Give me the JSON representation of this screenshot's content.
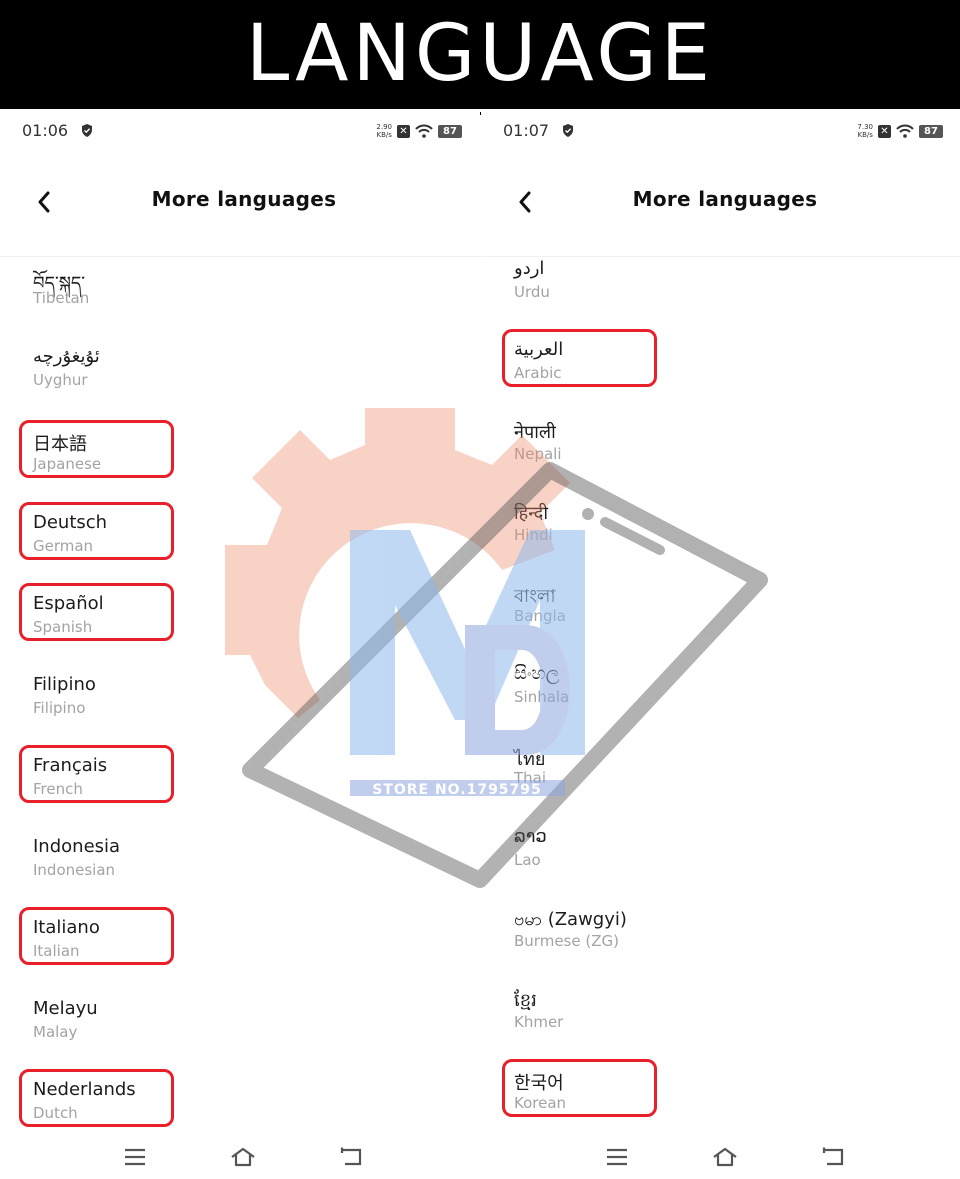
{
  "banner": {
    "title": "LANGUAGE"
  },
  "panes": [
    {
      "status": {
        "time": "01:06",
        "speed_value": "2.90",
        "speed_unit": "KB/s",
        "battery": "87"
      },
      "header": {
        "title": "More languages"
      },
      "items": [
        {
          "native": "བོད་སྐད་",
          "english": "Tibetan",
          "highlighted": false
        },
        {
          "native": "ئۇيغۇرچە",
          "english": "Uyghur",
          "highlighted": false
        },
        {
          "native": "日本語",
          "english": "Japanese",
          "highlighted": true
        },
        {
          "native": "Deutsch",
          "english": "German",
          "highlighted": true
        },
        {
          "native": "Español",
          "english": "Spanish",
          "highlighted": true
        },
        {
          "native": "Filipino",
          "english": "Filipino",
          "highlighted": false
        },
        {
          "native": "Français",
          "english": "French",
          "highlighted": true
        },
        {
          "native": "Indonesia",
          "english": "Indonesian",
          "highlighted": false
        },
        {
          "native": "Italiano",
          "english": "Italian",
          "highlighted": true
        },
        {
          "native": "Melayu",
          "english": "Malay",
          "highlighted": false
        },
        {
          "native": "Nederlands",
          "english": "Dutch",
          "highlighted": true
        }
      ]
    },
    {
      "status": {
        "time": "01:07",
        "speed_value": "7.30",
        "speed_unit": "KB/s",
        "battery": "87"
      },
      "header": {
        "title": "More languages"
      },
      "items": [
        {
          "native": "اردو",
          "english": "Urdu",
          "highlighted": false
        },
        {
          "native": "العربية",
          "english": "Arabic",
          "highlighted": true
        },
        {
          "native": "नेपाली",
          "english": "Nepali",
          "highlighted": false
        },
        {
          "native": "हिन्दी",
          "english": "Hindi",
          "highlighted": false
        },
        {
          "native": "বাংলা",
          "english": "Bangla",
          "highlighted": false
        },
        {
          "native": "සිංහල",
          "english": "Sinhala",
          "highlighted": false
        },
        {
          "native": "ไทย",
          "english": "Thai",
          "highlighted": false
        },
        {
          "native": "ລາວ",
          "english": "Lao",
          "highlighted": false
        },
        {
          "native": "ဗမာ (Zawgyi)",
          "english": "Burmese (ZG)",
          "highlighted": false
        },
        {
          "native": "ខ្មែរ",
          "english": "Khmer",
          "highlighted": false
        },
        {
          "native": "한국어",
          "english": "Korean",
          "highlighted": true
        }
      ]
    }
  ],
  "watermark": {
    "text": "STORE NO.1795795"
  },
  "colors": {
    "highlight": "#e8202a",
    "banner_bg": "#000000",
    "secondary_text": "#a3a3a3"
  },
  "icons": {
    "back": "chevron-left-icon",
    "menu": "menu-icon",
    "home": "home-icon",
    "recent": "back-arrow-icon",
    "shield": "shield-icon",
    "wifi": "wifi-icon"
  }
}
